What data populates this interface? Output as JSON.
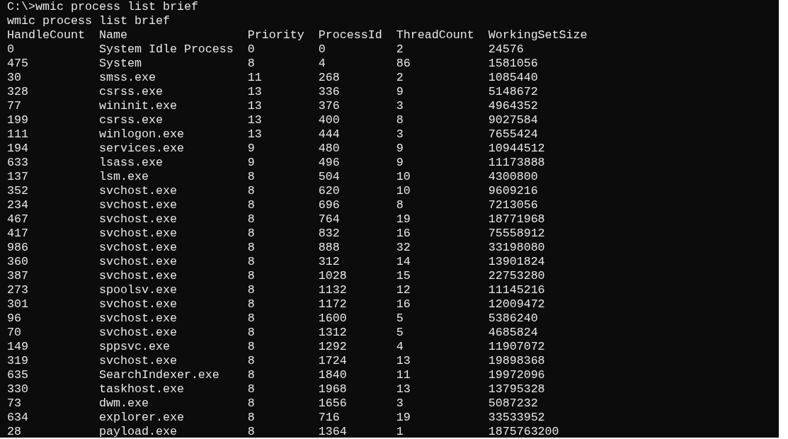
{
  "console": {
    "prompt_line": "C:\\>wmic process list brief",
    "echo_line": "wmic process list brief",
    "columns": [
      "HandleCount",
      "Name",
      "Priority",
      "ProcessId",
      "ThreadCount",
      "WorkingSetSize"
    ],
    "rows": [
      [
        "0",
        "System Idle Process",
        "0",
        "0",
        "2",
        "24576"
      ],
      [
        "475",
        "System",
        "8",
        "4",
        "86",
        "1581056"
      ],
      [
        "30",
        "smss.exe",
        "11",
        "268",
        "2",
        "1085440"
      ],
      [
        "328",
        "csrss.exe",
        "13",
        "336",
        "9",
        "5148672"
      ],
      [
        "77",
        "wininit.exe",
        "13",
        "376",
        "3",
        "4964352"
      ],
      [
        "199",
        "csrss.exe",
        "13",
        "400",
        "8",
        "9027584"
      ],
      [
        "111",
        "winlogon.exe",
        "13",
        "444",
        "3",
        "7655424"
      ],
      [
        "194",
        "services.exe",
        "9",
        "480",
        "9",
        "10944512"
      ],
      [
        "633",
        "lsass.exe",
        "9",
        "496",
        "9",
        "11173888"
      ],
      [
        "137",
        "lsm.exe",
        "8",
        "504",
        "10",
        "4300800"
      ],
      [
        "352",
        "svchost.exe",
        "8",
        "620",
        "10",
        "9609216"
      ],
      [
        "234",
        "svchost.exe",
        "8",
        "696",
        "8",
        "7213056"
      ],
      [
        "467",
        "svchost.exe",
        "8",
        "764",
        "19",
        "18771968"
      ],
      [
        "417",
        "svchost.exe",
        "8",
        "832",
        "16",
        "75558912"
      ],
      [
        "986",
        "svchost.exe",
        "8",
        "888",
        "32",
        "33198080"
      ],
      [
        "360",
        "svchost.exe",
        "8",
        "312",
        "14",
        "13901824"
      ],
      [
        "387",
        "svchost.exe",
        "8",
        "1028",
        "15",
        "22753280"
      ],
      [
        "273",
        "spoolsv.exe",
        "8",
        "1132",
        "12",
        "11145216"
      ],
      [
        "301",
        "svchost.exe",
        "8",
        "1172",
        "16",
        "12009472"
      ],
      [
        "96",
        "svchost.exe",
        "8",
        "1600",
        "5",
        "5386240"
      ],
      [
        "70",
        "svchost.exe",
        "8",
        "1312",
        "5",
        "4685824"
      ],
      [
        "149",
        "sppsvc.exe",
        "8",
        "1292",
        "4",
        "11907072"
      ],
      [
        "319",
        "svchost.exe",
        "8",
        "1724",
        "13",
        "19898368"
      ],
      [
        "635",
        "SearchIndexer.exe",
        "8",
        "1840",
        "11",
        "19972096"
      ],
      [
        "330",
        "taskhost.exe",
        "8",
        "1968",
        "13",
        "13795328"
      ],
      [
        "73",
        "dwm.exe",
        "8",
        "1656",
        "3",
        "5087232"
      ],
      [
        "634",
        "explorer.exe",
        "8",
        "716",
        "19",
        "33533952"
      ],
      [
        "28",
        "payload.exe",
        "8",
        "1364",
        "1",
        "1875763200"
      ]
    ]
  }
}
